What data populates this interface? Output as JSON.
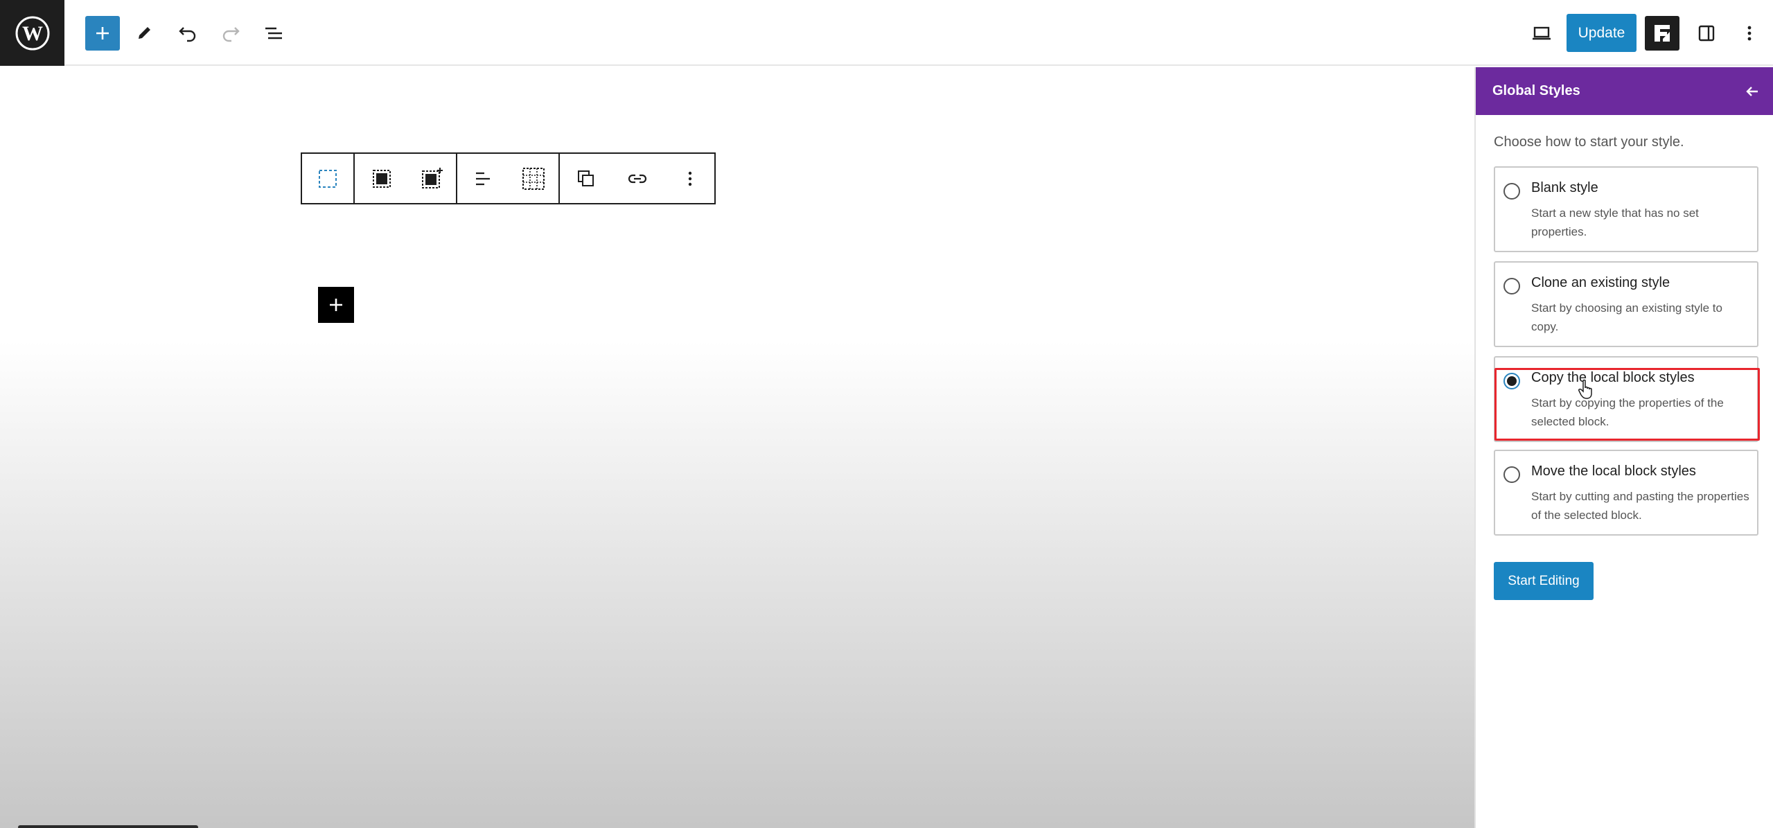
{
  "topbar": {
    "update_label": "Update"
  },
  "icons": {
    "logo": "wordpress-logo-icon",
    "add": "plus-icon",
    "edit": "pencil-icon",
    "undo": "undo-icon",
    "redo": "redo-icon",
    "list_view": "list-view-icon",
    "view": "laptop-preview-icon",
    "plugin": "plugin-logo-icon",
    "sidebar": "sidebar-toggle-icon",
    "more": "kebab-menu-icon"
  },
  "block_toolbar": {
    "buttons": [
      "select-parent",
      "cover",
      "add-cover",
      "align",
      "grid",
      "duplicate",
      "link",
      "more"
    ]
  },
  "sidebar": {
    "title": "Global Styles",
    "hint": "Choose how to start your style.",
    "options": [
      {
        "label": "Blank style",
        "description": "Start a new style that has no set properties.",
        "checked": false
      },
      {
        "label": "Clone an existing style",
        "description": "Start by choosing an existing style to copy.",
        "checked": false
      },
      {
        "label": "Copy the local block styles",
        "description": "Start by copying the properties of the selected block.",
        "checked": true
      },
      {
        "label": "Move the local block styles",
        "description": "Start by cutting and pasting the properties of the selected block.",
        "checked": false
      }
    ],
    "start_label": "Start Editing"
  },
  "colors": {
    "accent": "#1a85c2",
    "header": "#6c2a9e",
    "highlight": "#e8262e"
  }
}
